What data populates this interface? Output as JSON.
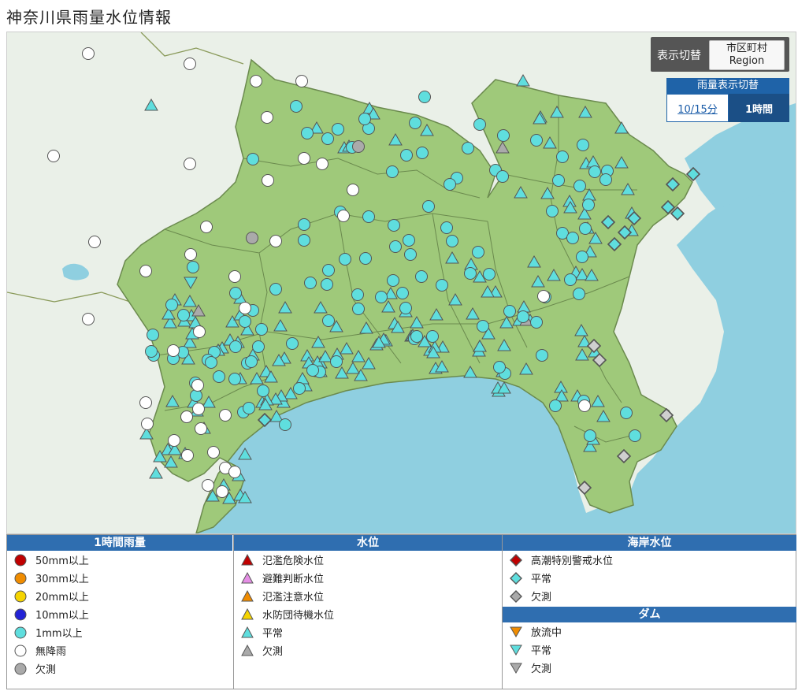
{
  "page_title": "神奈川県雨量水位情報",
  "toggle": {
    "label": "表示切替",
    "region_btn_line1": "市区町村",
    "region_btn_line2": "Region"
  },
  "rain_toggle": {
    "header": "雨量表示切替",
    "btn_10min": "10/15分",
    "btn_1hour": "1時間"
  },
  "colors": {
    "land": "#9fc97a",
    "outside": "#eaf0e8",
    "sea": "#8fcfe0",
    "station_rain": "#5fdede",
    "station_norain": "#ffffff",
    "station_missing": "#aaaaaa",
    "header_blue": "#2f6eb0"
  },
  "legend": {
    "rain": {
      "title": "1時間雨量",
      "items": [
        {
          "label": "50mm以上",
          "color": "#c00000"
        },
        {
          "label": "30mm以上",
          "color": "#f08c00"
        },
        {
          "label": "20mm以上",
          "color": "#f5d400"
        },
        {
          "label": "10mm以上",
          "color": "#2323d6"
        },
        {
          "label": "1mm以上",
          "color": "#5fdede"
        },
        {
          "label": "無降雨",
          "color": "#ffffff"
        },
        {
          "label": "欠測",
          "color": "#aaaaaa"
        }
      ]
    },
    "water": {
      "title": "水位",
      "items": [
        {
          "label": "氾濫危険水位",
          "color": "#c00000"
        },
        {
          "label": "避難判断水位",
          "color": "#e58ee5"
        },
        {
          "label": "氾濫注意水位",
          "color": "#f08c00"
        },
        {
          "label": "水防団待機水位",
          "color": "#f5d400"
        },
        {
          "label": "平常",
          "color": "#5fdede"
        },
        {
          "label": "欠測",
          "color": "#aaaaaa"
        }
      ]
    },
    "coast": {
      "title": "海岸水位",
      "items": [
        {
          "label": "高潮特別警戒水位",
          "color": "#c00000"
        },
        {
          "label": "平常",
          "color": "#5fdede"
        },
        {
          "label": "欠測",
          "color": "#aaaaaa"
        }
      ]
    },
    "dam": {
      "title": "ダム",
      "items": [
        {
          "label": "放流中",
          "color": "#f08c00"
        },
        {
          "label": "平常",
          "color": "#5fdede"
        },
        {
          "label": "欠測",
          "color": "#aaaaaa"
        }
      ]
    }
  }
}
